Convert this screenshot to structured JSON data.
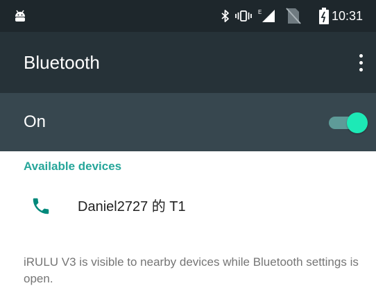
{
  "status_bar": {
    "time": "10:31",
    "icons": [
      "android-icon",
      "bluetooth-icon",
      "vibrate-icon",
      "signal-icon",
      "no-sim-icon",
      "battery-icon"
    ],
    "background": "#1e272c"
  },
  "app_bar": {
    "title": "Bluetooth",
    "menu_icon": "overflow-menu-icon",
    "background": "#263238"
  },
  "toggle": {
    "label": "On",
    "state": "on",
    "background": "#37474f",
    "thumb_color": "#1de9b6"
  },
  "available_devices": {
    "header": "Available devices",
    "items": [
      {
        "name": "Daniel2727 的 T1",
        "icon": "phone-icon"
      }
    ]
  },
  "footer": {
    "note": "iRULU V3 is visible to nearby devices while Bluetooth settings is open."
  },
  "colors": {
    "accent": "#26a69a",
    "text_primary": "#212121",
    "text_secondary": "#757575"
  }
}
